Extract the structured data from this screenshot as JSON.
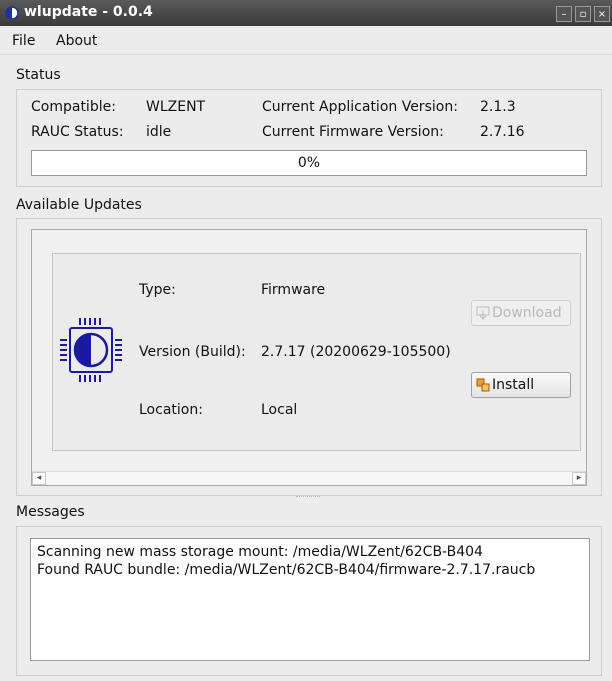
{
  "window": {
    "title": "wlupdate - 0.0.4",
    "minimize_label": "–",
    "restore_label": "▫",
    "close_label": "×"
  },
  "menu": [
    "File",
    "About"
  ],
  "status": {
    "section_label": "Status",
    "compatible_label": "Compatible:",
    "compatible_value": "WLZENT",
    "rauc_label": "RAUC Status:",
    "rauc_value": "idle",
    "app_version_label": "Current Application Version:",
    "app_version_value": "2.1.3",
    "fw_version_label": "Current Firmware Version:",
    "fw_version_value": "2.7.16",
    "progress_text": "0%",
    "progress_value": 0
  },
  "updates": {
    "section_label": "Available Updates",
    "item": {
      "type_label": "Type:",
      "type_value": "Firmware",
      "version_label": "Version (Build):",
      "version_value": "2.7.17 (20200629-105500)",
      "location_label": "Location:",
      "location_value": "Local",
      "download_label": "Download",
      "install_label": "Install",
      "icon": "firmware-chip-icon"
    }
  },
  "messages": {
    "section_label": "Messages",
    "lines": [
      "Scanning new mass storage mount: /media/WLZent/62CB-B404",
      "Found RAUC bundle: /media/WLZent/62CB-B404/firmware-2.7.17.raucb"
    ]
  },
  "colors": {
    "accent": "#1a1aa0",
    "titlebar": "#454545"
  }
}
